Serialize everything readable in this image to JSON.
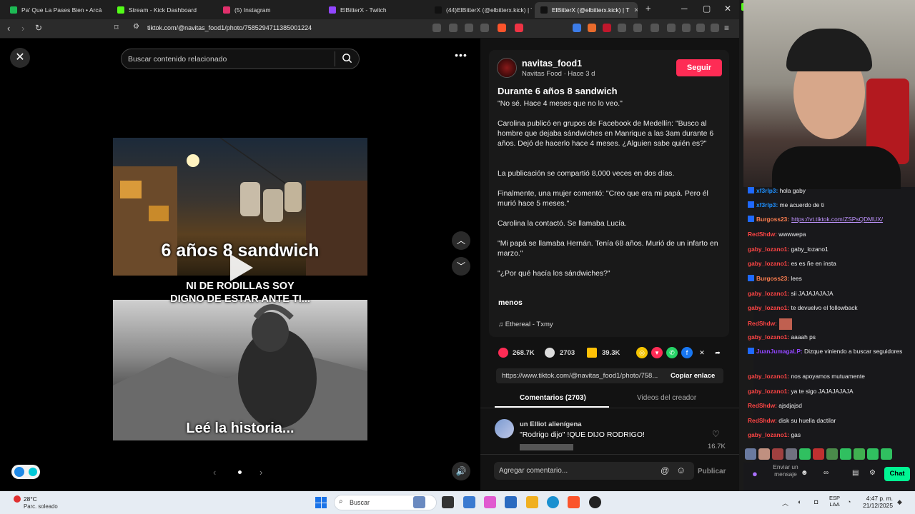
{
  "browser": {
    "tabs": [
      {
        "label": "Pa' Que La Pases Bien • Arcá",
        "color": "#1db954"
      },
      {
        "label": "Stream - Kick Dashboard",
        "color": "#53fc18"
      },
      {
        "label": "(5) Instagram",
        "color": "#e1306c"
      },
      {
        "label": "ElBitterX - Twitch",
        "color": "#9146ff"
      },
      {
        "label": "(44)ElBitterX (@elbitterx.kick) | T",
        "color": "#111111"
      },
      {
        "label": "ElBitterX (@elbitterx.kick) | T",
        "color": "#111111"
      }
    ],
    "new_tab": "+",
    "url": "tiktok.com/@navitas_food1/photo/7585294711385001224"
  },
  "viewer": {
    "close": "✕",
    "search_placeholder": "Buscar contenido relacionado",
    "more": "•••",
    "caption_1": "6 años 8 sandwich",
    "caption_2_line1": "NI DE RODILLAS SOY",
    "caption_2_line2": "DIGNO DE ESTAR ANTE TI...",
    "caption_3": "Leé la historia...",
    "up": "︿",
    "down": "﹀",
    "volume": "🔊",
    "pager_prev": "‹",
    "pager_next": "›"
  },
  "post": {
    "username": "navitas_food1",
    "subline": "Navitas Food · Hace 3 d",
    "follow": "Seguir",
    "title": "Durante 6 años 8 sandwich",
    "paragraphs": [
      "\"No sé. Hace 4 meses que no lo veo.\"",
      "Carolina publicó en grupos de Facebook de Medellín: \"Busco al hombre que dejaba sándwiches en Manrique a las 3am durante 6 años. Dejó de hacerlo hace 4 meses. ¿Alguien sabe quién es?\"",
      "La publicación se compartió 8,000 veces en dos días.",
      "Finalmente, una mujer comentó: \"Creo que era mi papá. Pero él murió hace 5 meses.\"",
      "Carolina la contactó. Se llamaba Lucía.",
      "\"Mi papá se llamaba Hernán. Tenía 68 años. Murió de un infarto en marzo.\"",
      "\"¿Por qué hacía los sándwiches?\""
    ],
    "less": "menos",
    "music": "♫  Ethereal - Txmy",
    "likes": "268.7K",
    "comments": "2703",
    "saves": "39.3K",
    "link": "https://www.tiktok.com/@navitas_food1/photo/758...",
    "copy_link": "Copiar enlace",
    "tab_comments": "Comentarios (2703)",
    "tab_videos": "Videos del creador",
    "comment": {
      "user": "un Elliot alienígena",
      "text": "\"Rodrigo dijo\" !QUE DIJO RODRIGO!",
      "likes": "16.7K"
    },
    "comment_placeholder": "Agregar comentario...",
    "at": "@",
    "emoji": "☺",
    "publish": "Publicar"
  },
  "chat": {
    "lines": [
      {
        "user": "xf3rlp3:",
        "msg": " hola gaby",
        "cls": "u-blue",
        "badge": true
      },
      {
        "user": "xf3rlp3:",
        "msg": " me acuerdo de ti",
        "cls": "u-blue",
        "badge": true
      },
      {
        "user": "Burgoss23:",
        "msg": "https://vt.tiktok.com/ZSPsQDMUX/",
        "cls": "u-or",
        "badge": true,
        "link": true
      },
      {
        "user": "RedShdw:",
        "msg": " wwwwepa",
        "cls": "u-red",
        "badge": false
      },
      {
        "user": "gaby_lozano1:",
        "msg": " gaby_lozano1",
        "cls": "u-red",
        "badge": false
      },
      {
        "user": "gaby_lozano1:",
        "msg": " es es ñe en insta",
        "cls": "u-red",
        "badge": false
      },
      {
        "user": "Burgoss23:",
        "msg": " lees",
        "cls": "u-or",
        "badge": true
      },
      {
        "user": "gaby_lozano1:",
        "msg": " sii JAJAJAJAJA",
        "cls": "u-red",
        "badge": false
      },
      {
        "user": "gaby_lozano1:",
        "msg": " te devuelvo el followback",
        "cls": "u-red",
        "badge": false
      },
      {
        "user": "RedShdw:",
        "msg": "",
        "cls": "u-red",
        "badge": false
      },
      {
        "user": "gaby_lozano1:",
        "msg": " aaaah ps",
        "cls": "u-red",
        "badge": false
      },
      {
        "user": "JuanJumagaLP:",
        "msg": " Dizque viniendo a buscar seguidores",
        "cls": "u-green",
        "badge": true
      },
      {
        "user": "gaby_lozano1:",
        "msg": " nos apoyamos mutuamente",
        "cls": "u-red",
        "badge": false
      },
      {
        "user": "gaby_lozano1:",
        "msg": " ya te sigo JAJAJAJAJA",
        "cls": "u-red",
        "badge": false
      },
      {
        "user": "RedShdw:",
        "msg": " ajsdjajsd",
        "cls": "u-red",
        "badge": false
      },
      {
        "user": "RedShdw:",
        "msg": " disk su huella dactilar",
        "cls": "u-red",
        "badge": false
      },
      {
        "user": "gaby_lozano1:",
        "msg": " gas",
        "cls": "u-red",
        "badge": false
      }
    ],
    "send_placeholder": "Enviar un mensaje",
    "chat_button": "Chat"
  },
  "taskbar": {
    "weather_temp": "28°C",
    "weather_desc": "Parc. soleado",
    "search": "Buscar",
    "lang": "ESP\nLAA",
    "time": "4:47 p. m.",
    "date": "21/12/2025"
  },
  "colors": {
    "accent": "#fe2c55",
    "twitch_chat_btn": "#00f593"
  }
}
